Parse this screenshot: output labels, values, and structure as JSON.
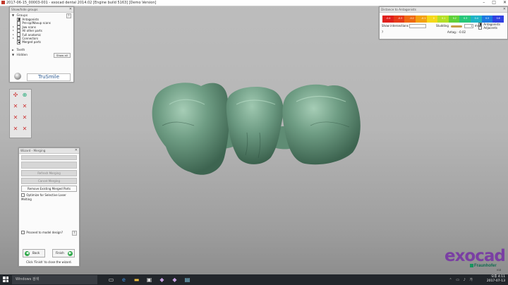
{
  "window": {
    "title": "2017-06-15_00003-001 - exocad dental 2014.02 [Engine build 5163] [Demo Version]",
    "controls": [
      "–",
      "□",
      "✕"
    ]
  },
  "groups_panel": {
    "header": "Show/hide groups",
    "close": "✕",
    "groups_label": "Groups",
    "help": "?",
    "items": [
      {
        "label": "Antagonists",
        "checked": true
      },
      {
        "label": "Pre-op/Waxup scans",
        "checked": false
      },
      {
        "label": "Jaw scans",
        "checked": false
      },
      {
        "label": "All other parts",
        "checked": false
      },
      {
        "label": "Full anatomic",
        "checked": false
      },
      {
        "label": "Connectors",
        "checked": false
      },
      {
        "label": "Merged parts",
        "checked": true
      }
    ],
    "teeth_label": "Teeth",
    "hidden_label": "Hidden",
    "show_all": "Show all",
    "brand": "TruSmile"
  },
  "wizard": {
    "header": "Wizard - Merging",
    "close": "✕",
    "btn_refresh": "Refresh Merging",
    "btn_cancel": "Cancel Merging",
    "btn_remove": "Remove Existing Merged Parts",
    "optimize_label": "Optimize for Selective Laser Melting",
    "proceed_label": "Proceed to model design?",
    "help": "?",
    "back_label": "Back",
    "finish_label": "Finish",
    "hint": "Click 'Finish' to close the wizard."
  },
  "distance_panel": {
    "header": "Distance to Antagonists",
    "close": "✕",
    "scale_values": [
      "-0.4",
      "-0.3",
      "-0.2",
      "-0.1",
      "0",
      "0.1",
      "0.2",
      "0.3",
      "0.4",
      "0.5",
      "0.6"
    ],
    "scale_colors": [
      "#e0201c",
      "#e63a18",
      "#ee6a12",
      "#f3a112",
      "#f5d81a",
      "#b5df26",
      "#5fd13a",
      "#27c77a",
      "#1fb2c6",
      "#1c78e0",
      "#3040e0"
    ],
    "show_intersections": "Show intersections",
    "studding_label": "Studding",
    "spin_value": "1",
    "unit": "mm",
    "antagonists_label": "Antagonists",
    "adjacents_label": "Adjacents",
    "help": "?",
    "antag_value": "Antag.: -0.02"
  },
  "logo": {
    "exocad": "exocad",
    "fraunhofer": "Fraunhofer",
    "sub": "IGD"
  },
  "taskbar": {
    "search_placeholder": "Windows 검색",
    "time": "오후 4:11",
    "date": "2017-07-13",
    "icons": [
      "task-view-icon",
      "edge-icon",
      "explorer-icon",
      "store-icon",
      "app-icon-1",
      "app-icon-2",
      "app-icon-3"
    ]
  }
}
